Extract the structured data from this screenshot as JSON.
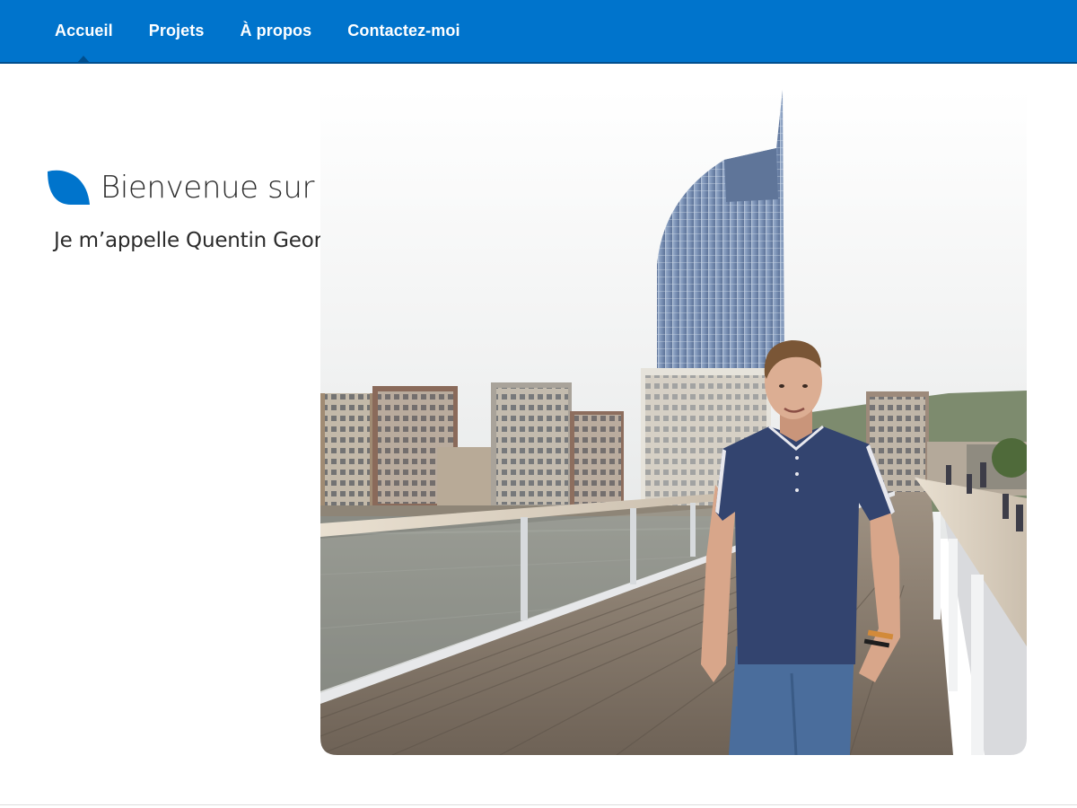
{
  "nav": {
    "items": [
      {
        "label": "Accueil",
        "active": true
      },
      {
        "label": "Projets",
        "active": false
      },
      {
        "label": "À propos",
        "active": false
      },
      {
        "label": "Contactez-moi",
        "active": false
      }
    ]
  },
  "hero": {
    "title": "Bienvenue sur mon portfolio",
    "subtitle": "Je m’appelle Quentin George, je suis Web Designer",
    "icon": "leaf-icon"
  },
  "colors": {
    "brand": "#0074cc",
    "brand_dark": "#004f8f",
    "text": "#2b2b2b",
    "background": "#ffffff"
  }
}
